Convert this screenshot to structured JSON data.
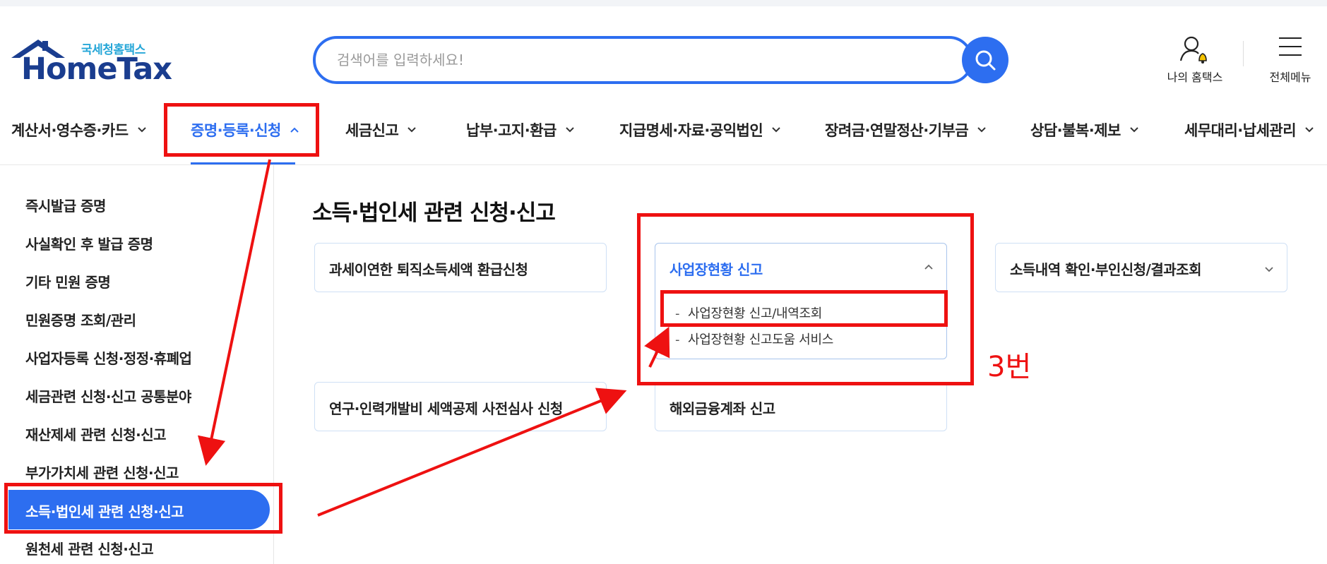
{
  "logo": {
    "sub": "국세청홈택스",
    "main": "HomeTax"
  },
  "search": {
    "placeholder": "검색어를 입력하세요!"
  },
  "header": {
    "my_hometax": "나의 홈택스",
    "all_menu": "전체메뉴"
  },
  "gnb": [
    {
      "label": "계산서·영수증·카드"
    },
    {
      "label": "증명·등록·신청",
      "active": true
    },
    {
      "label": "세금신고"
    },
    {
      "label": "납부·고지·환급"
    },
    {
      "label": "지급명세·자료·공익법인"
    },
    {
      "label": "장려금·연말정산·기부금"
    },
    {
      "label": "상담·불복·제보"
    },
    {
      "label": "세무대리·납세관리"
    }
  ],
  "sidebar": {
    "items": [
      "즉시발급 증명",
      "사실확인 후 발급 증명",
      "기타 민원 증명",
      "민원증명 조회/관리",
      "사업자등록 신청·정정·휴폐업",
      "세금관련 신청·신고 공통분야",
      "재산제세 관련 신청·신고",
      "부가가치세 관련 신청·신고",
      "소득·법인세 관련 신청·신고",
      "원천세 관련 신청·신고"
    ],
    "active_index": 8
  },
  "main": {
    "title": "소득·법인세 관련 신청·신고",
    "cards": [
      {
        "label": "과세이연한 퇴직소득세액 환급신청"
      },
      {
        "label": "사업장현황 신고",
        "open": true,
        "sub": [
          "사업장현황 신고/내역조회",
          "사업장현황 신고도움 서비스"
        ]
      },
      {
        "label": "소득내역 확인·부인신청/결과조회"
      },
      {
        "label": "연구·인력개발비 세액공제 사전심사 신청"
      },
      {
        "label": "해외금융계좌 신고"
      }
    ]
  },
  "annotation": {
    "step_label": "3번",
    "color": "#ee1111"
  },
  "colors": {
    "accent": "#2d6ef0",
    "logo_navy": "#1a3d8f",
    "logo_sky": "#27a7d8"
  }
}
